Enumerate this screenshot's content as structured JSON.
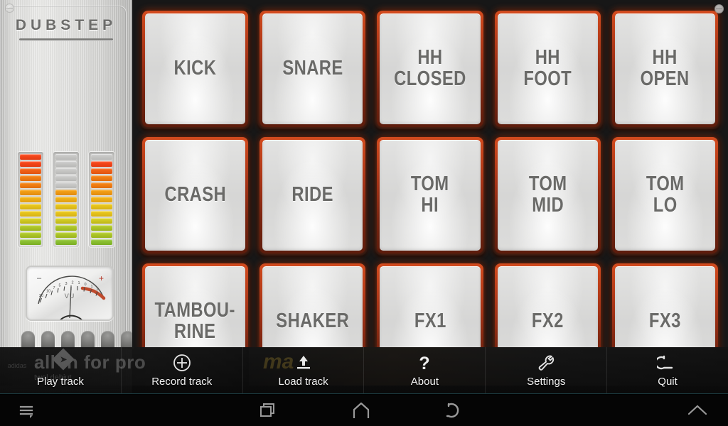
{
  "app": {
    "kit_name": "DUBSTEP",
    "screw_icon": "screw-icon"
  },
  "meters": {
    "label": "VU",
    "vu_minus": "–",
    "vu_plus": "+",
    "vu_scale_ticks": [
      "20",
      "10",
      "7",
      "5",
      "3",
      "2",
      "1",
      "0",
      "1",
      "2",
      "3"
    ],
    "channels": [
      {
        "name": "meter-left",
        "segments": 13,
        "lit": 13
      },
      {
        "name": "meter-mid",
        "segments": 13,
        "lit": 8
      },
      {
        "name": "meter-right",
        "segments": 13,
        "lit": 12
      }
    ],
    "knob_count": 6
  },
  "pads": {
    "rows": [
      [
        {
          "label": "KICK"
        },
        {
          "label": "SNARE"
        },
        {
          "label": "HH\nCLOSED"
        },
        {
          "label": "HH\nFOOT"
        },
        {
          "label": "HH\nOPEN"
        }
      ],
      [
        {
          "label": "CRASH"
        },
        {
          "label": "RIDE"
        },
        {
          "label": "TOM\nHI"
        },
        {
          "label": "TOM\nMID"
        },
        {
          "label": "TOM\nLO"
        }
      ],
      [
        {
          "label": "TAMBOU-\nRINE"
        },
        {
          "label": "SHAKER"
        },
        {
          "label": "FX1"
        },
        {
          "label": "FX2"
        },
        {
          "label": "FX3"
        }
      ]
    ]
  },
  "toolbar": {
    "items": [
      {
        "label": "Play track",
        "icon": "play-icon"
      },
      {
        "label": "Record track",
        "icon": "plus-circle-icon"
      },
      {
        "label": "Load track",
        "icon": "upload-icon"
      },
      {
        "label": "About",
        "icon": "question-mark-icon"
      },
      {
        "label": "Settings",
        "icon": "wrench-icon"
      },
      {
        "label": "Quit",
        "icon": "back-arrow-icon"
      }
    ]
  },
  "ad": {
    "headline": "all in for pro",
    "subline": "twol debiut",
    "brand": "adidas",
    "right_text": "ma"
  },
  "navbar": {
    "menu": "menu-icon",
    "recents": "recents-icon",
    "home": "home-icon",
    "back": "back-icon",
    "expand": "chevron-up-icon"
  },
  "colors": {
    "pad_glow": "#d24b1e",
    "pad_face": "#dcdcdb",
    "panel_metal": "#dededc",
    "led_red": "#f4451c",
    "led_orange": "#f9a01b",
    "led_yellow": "#e8d927",
    "led_green": "#93cc3c",
    "led_off": "#c6c6c4",
    "toolbar_bg": "#0d0d0d"
  }
}
